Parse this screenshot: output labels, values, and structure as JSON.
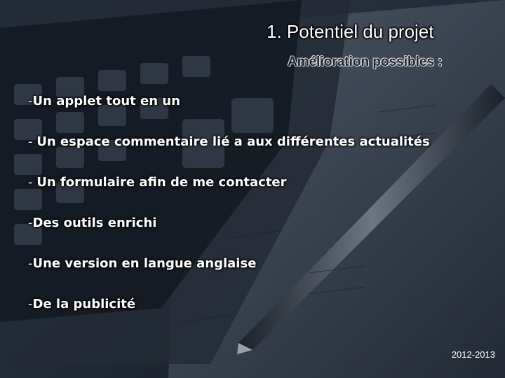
{
  "slide": {
    "title": "1.  Potentiel du projet",
    "subtitle": "Amélioration possibles :",
    "bullets": [
      {
        "dash": "-",
        "text": "Un applet tout en un"
      },
      {
        "dash": "- ",
        "text": "Un espace commentaire lié a aux différentes actualités"
      },
      {
        "dash": "- ",
        "text": "Un formulaire afin de me contacter"
      },
      {
        "dash": "-",
        "text": "Des outils enrichi"
      },
      {
        "dash": "-",
        "text": "Une version en langue anglaise"
      },
      {
        "dash": "-",
        "text": "De la publicité"
      }
    ],
    "footer_year": "2012-2013"
  }
}
